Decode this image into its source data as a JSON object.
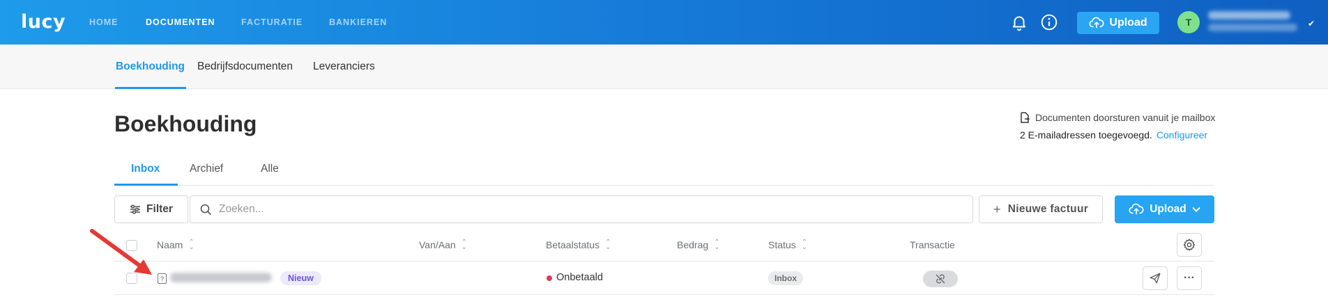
{
  "colors": {
    "accent": "#1f98ea",
    "topbar_start": "#1e9bea",
    "topbar_end": "#0f5fc1",
    "unpaid_dot": "#e5394a",
    "new_badge": "#6d54d6",
    "annotation_arrow": "#e53935"
  },
  "topbar": {
    "logo": "lucy",
    "nav": [
      "HOME",
      "DOCUMENTEN",
      "FACTURATIE",
      "BANKIEREN"
    ],
    "active_nav": "DOCUMENTEN",
    "icons": [
      "bell-icon",
      "info-icon"
    ],
    "upload_label": "Upload",
    "avatar_initial": "T"
  },
  "subnav": {
    "items": [
      "Boekhouding",
      "Bedrijfsdocumenten",
      "Leveranciers"
    ],
    "active": "Boekhouding"
  },
  "page": {
    "title": "Boekhouding",
    "forward_label": "Documenten doorsturen vanuit je mailbox",
    "emails_added": "2 E-mailadressen toegevoegd.",
    "configure_link": "Configureer"
  },
  "tabs": {
    "items": [
      "Inbox",
      "Archief",
      "Alle"
    ],
    "active": "Inbox"
  },
  "toolbar": {
    "filter_label": "Filter",
    "search_placeholder": "Zoeken...",
    "new_invoice_label": "Nieuwe factuur",
    "upload_label": "Upload"
  },
  "table": {
    "columns": [
      "Naam",
      "Van/Aan",
      "Betaalstatus",
      "Bedrag",
      "Status",
      "Transactie"
    ],
    "rows": [
      {
        "badge": "Nieuw",
        "payment_status": "Onbetaald",
        "status": "Inbox"
      }
    ]
  }
}
